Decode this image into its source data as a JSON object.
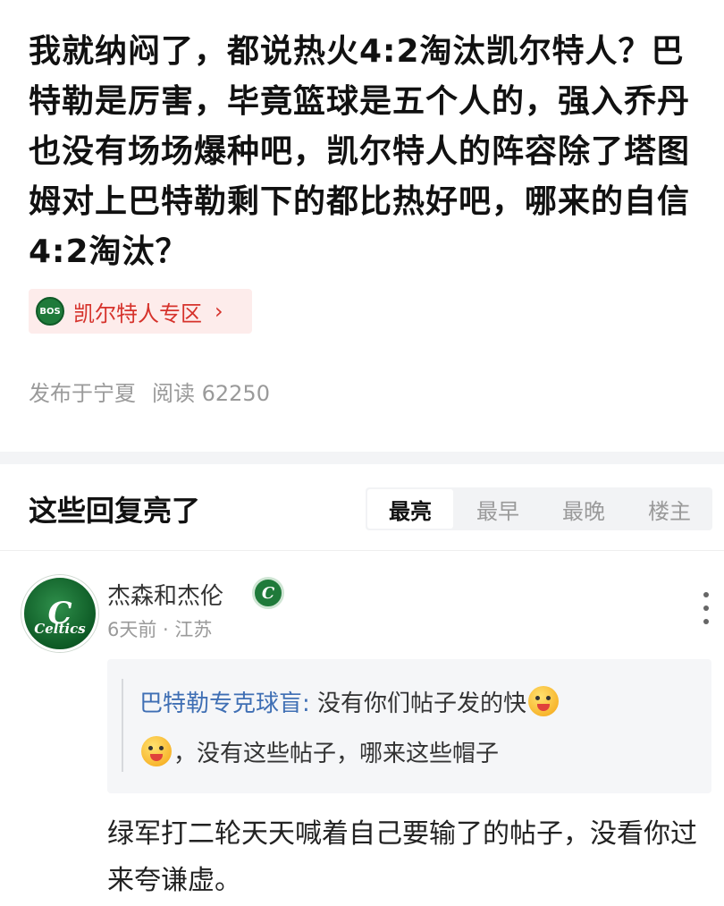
{
  "post": {
    "title": "我就纳闷了，都说热火4:2淘汰凯尔特人？巴特勒是厉害，毕竟篮球是五个人的，强入乔丹也没有场场爆种吧，凯尔特人的阵容除了塔图姆对上巴特勒剩下的都比热好吧，哪来的自信4:2淘汰？",
    "forum_tag": {
      "badge_text": "BOS",
      "label": "凯尔特人专区",
      "chevron": "›"
    },
    "location": "发布于宁夏",
    "views": "阅读 62250"
  },
  "replies_section": {
    "title": "这些回复亮了",
    "sort_tabs": [
      "最亮",
      "最早",
      "最晚",
      "楼主"
    ],
    "active_tab": "最亮"
  },
  "reply": {
    "avatar_letter": "C",
    "avatar_text": "Celtics",
    "username": "杰森和杰伦",
    "badge_letter": "C",
    "time_location": "6天前 · 江苏",
    "quote": {
      "author": "巴特勒专克球盲:",
      "text_part1": " 没有你们帖子发的快",
      "text_part2": "，没有这些帖子，哪来这些帽子"
    },
    "body": "绿军打二轮天天喊着自己要输了的帖子，没看你过来夸谦虚。"
  },
  "colors": {
    "accent_red": "#d6322b",
    "tag_bg": "#fdeceb",
    "link_blue": "#3f6fb4",
    "celtics_green": "#1f7a3a"
  },
  "icons": [
    "bos-badge-icon",
    "chevron-right-icon",
    "more-vertical-icon",
    "celtics-badge-icon",
    "emoji-icon"
  ]
}
